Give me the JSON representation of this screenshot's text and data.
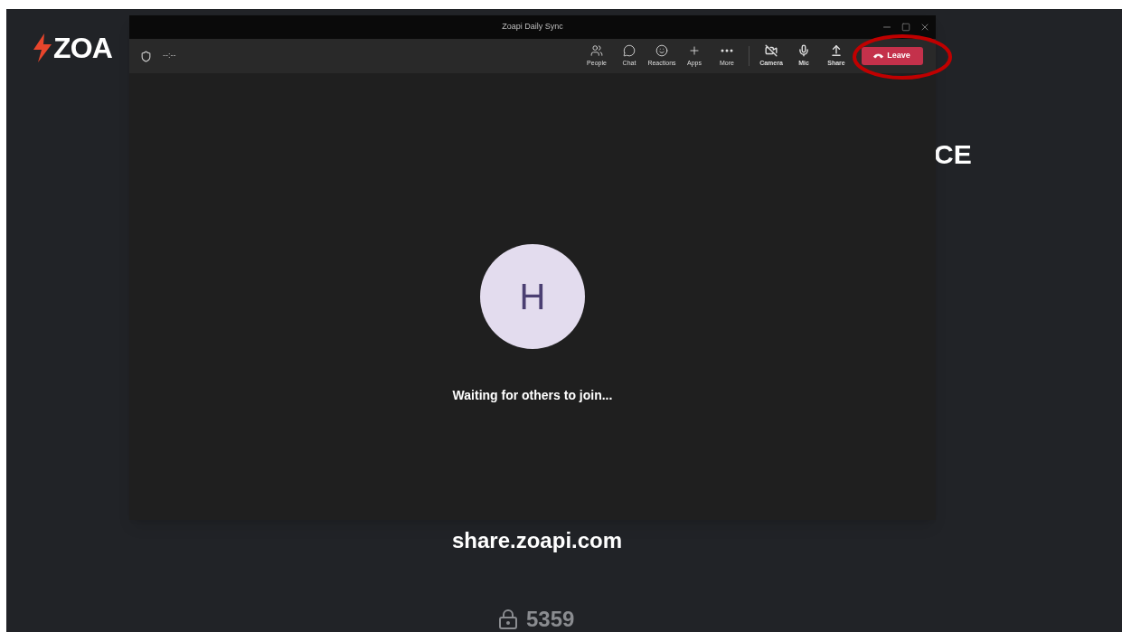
{
  "background": {
    "logo": "ZOA",
    "heading_fragment": "CE",
    "url": "share.zoapi.com",
    "code": "5359"
  },
  "window": {
    "title": "Zoapi Daily Sync",
    "timer": "--:--"
  },
  "toolbar": [
    {
      "label": "People"
    },
    {
      "label": "Chat"
    },
    {
      "label": "Reactions"
    },
    {
      "label": "Apps"
    },
    {
      "label": "More"
    },
    {
      "label": "Camera"
    },
    {
      "label": "Mic"
    },
    {
      "label": "Share"
    }
  ],
  "leave_button": "Leave",
  "avatar": {
    "initial": "H"
  },
  "status": "Waiting for others to join..."
}
